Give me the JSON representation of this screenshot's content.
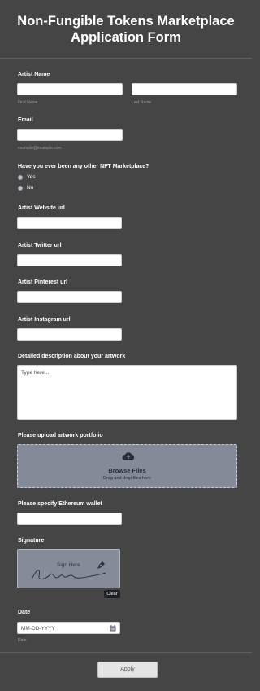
{
  "header": {
    "title": "Non-Fungible Tokens Marketplace Application Form"
  },
  "artist_name": {
    "label": "Artist Name",
    "first_sub": "First Name",
    "last_sub": "Last Name"
  },
  "email": {
    "label": "Email",
    "sub": "example@example.com"
  },
  "marketplace": {
    "question": "Have you ever been any other NFT Marketplace?",
    "options": [
      "Yes",
      "No"
    ]
  },
  "website": {
    "label": "Artist Website url"
  },
  "twitter": {
    "label": "Artist Twitter url"
  },
  "pinterest": {
    "label": "Artist Pinterest url"
  },
  "instagram": {
    "label": "Artist Instagram url"
  },
  "description": {
    "label": "Detailed description about your artwork",
    "placeholder": "Type here..."
  },
  "upload": {
    "label": "Please upload artwork portfolio",
    "browse": "Browse Files",
    "hint": "Drag and drop files here"
  },
  "wallet": {
    "label": "Please specify Ethereum wallet"
  },
  "signature": {
    "label": "Signature",
    "sign_here": "Sign Here",
    "clear": "Clear"
  },
  "date": {
    "label": "Date",
    "placeholder": "MM-DD-YYYY",
    "sub": "Date"
  },
  "footer": {
    "apply": "Apply"
  },
  "colors": {
    "background": "#454545",
    "input": "#ffffff",
    "upload_area": "#858a99",
    "clear_button": "#1e1f22"
  }
}
